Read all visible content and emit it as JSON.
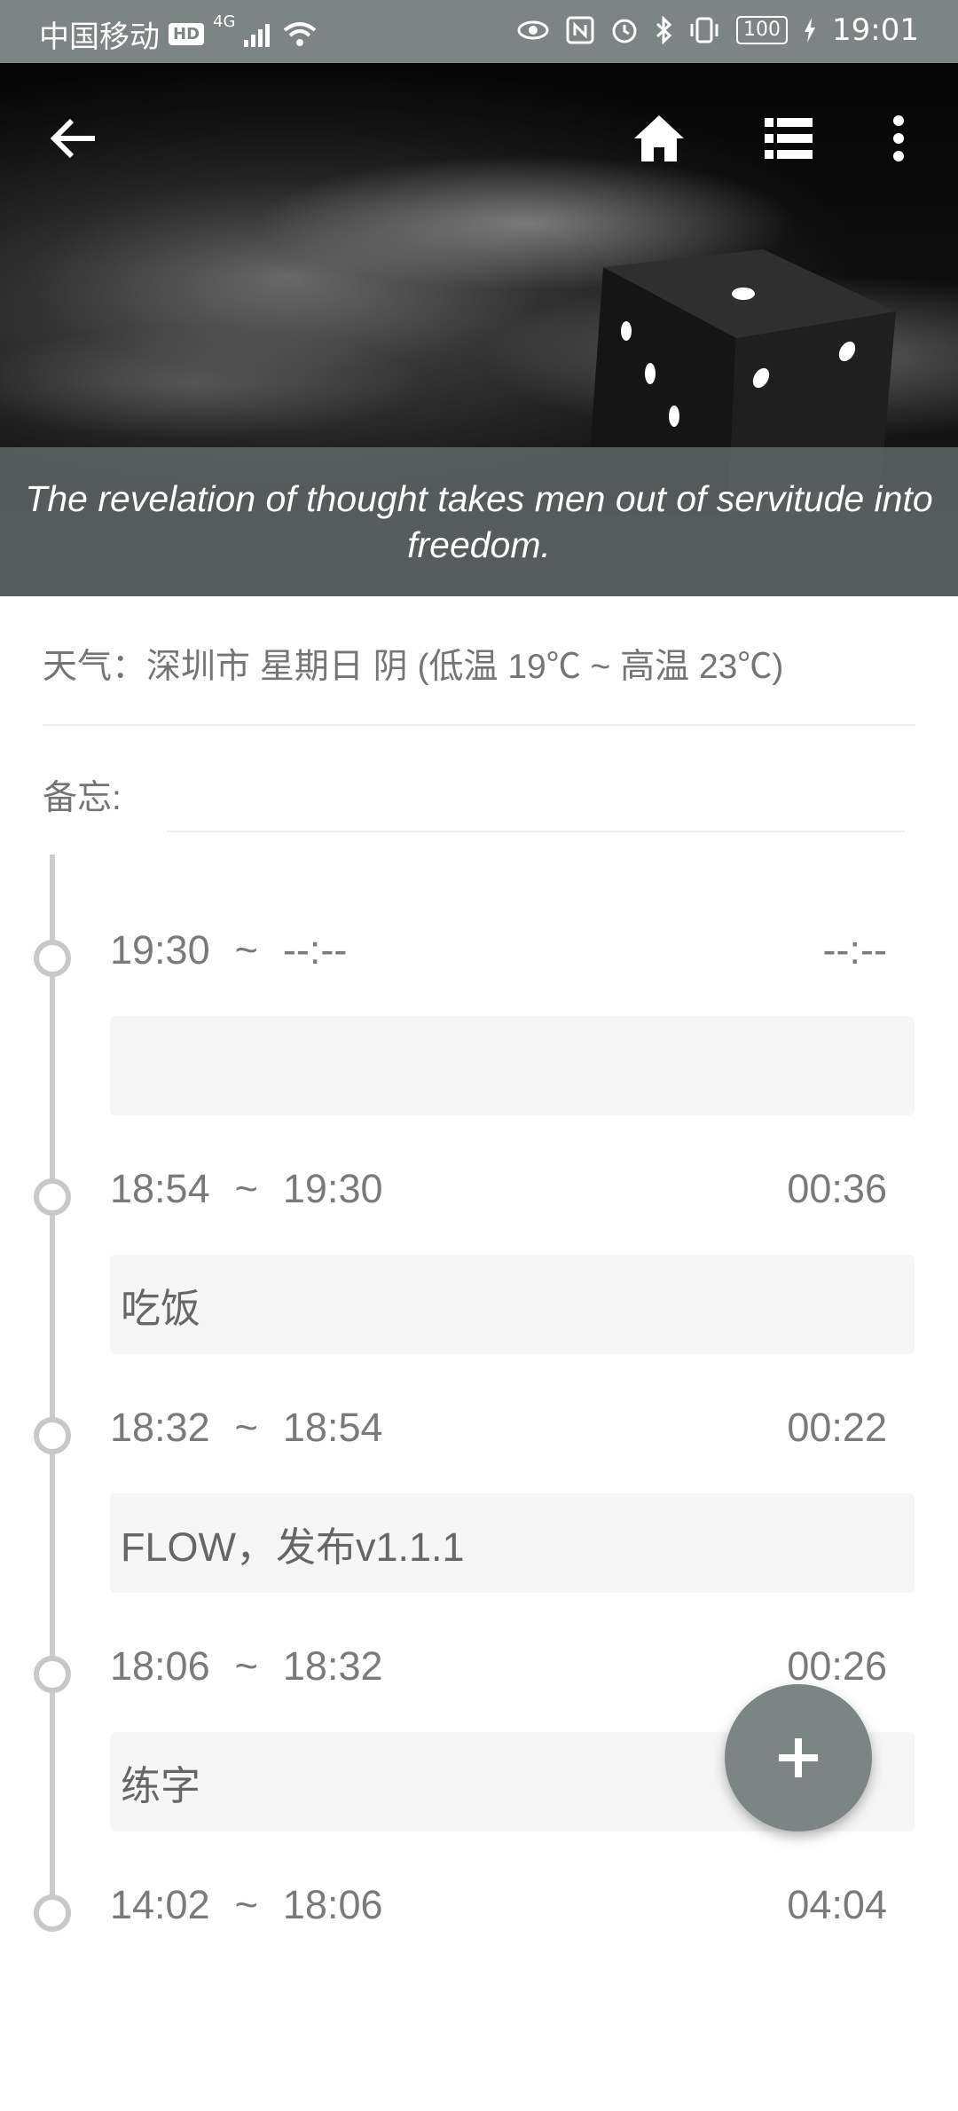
{
  "status_bar": {
    "carrier": "中国移动",
    "hd": "HD",
    "network": "4G",
    "battery": "100",
    "time": "19:01",
    "icons": [
      "eye-icon",
      "nfc-icon",
      "alarm-icon",
      "bluetooth-icon",
      "vibrate-icon",
      "battery-icon",
      "charging-icon"
    ]
  },
  "header": {
    "quote": "The revelation of thought takes men out of servitude into freedom.",
    "icons": [
      "back-arrow-icon",
      "home-icon",
      "list-icon",
      "more-vert-icon"
    ]
  },
  "info": {
    "weather": "天气：深圳市 星期日 阴 (低温 19℃ ~ 高温 23℃)",
    "memo_label": "备忘:"
  },
  "timeline": {
    "entries": [
      {
        "start": "19:30",
        "sep": "~",
        "end": "--:--",
        "duration": "--:--",
        "note": ""
      },
      {
        "start": "18:54",
        "sep": "~",
        "end": "19:30",
        "duration": "00:36",
        "note": "吃饭"
      },
      {
        "start": "18:32",
        "sep": "~",
        "end": "18:54",
        "duration": "00:22",
        "note": "FLOW，发布v1.1.1"
      },
      {
        "start": "18:06",
        "sep": "~",
        "end": "18:32",
        "duration": "00:26",
        "note": "练字"
      },
      {
        "start": "14:02",
        "sep": "~",
        "end": "18:06",
        "duration": "04:04",
        "note": ""
      }
    ]
  },
  "fab": {
    "icon": "plus-icon"
  },
  "colors": {
    "accent": "#7c8584",
    "timeline": "#c8c8c8",
    "note_bg": "#f6f6f6"
  }
}
